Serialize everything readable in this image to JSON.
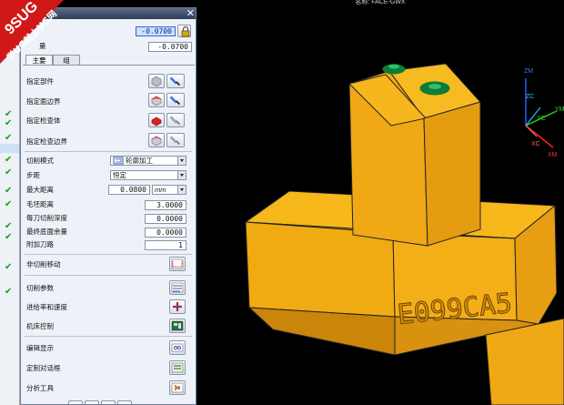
{
  "viewport": {
    "title": "名称: FACE-GWX",
    "engraving": "E099CA5"
  },
  "watermark": {
    "line1": "9SUG",
    "line2": "学UG就上UG网"
  },
  "dialog": {
    "top_value": "-0.0700",
    "top_label": "量",
    "second_value": "-0.0700",
    "tabs": [
      "主要",
      "组"
    ],
    "geometry": [
      {
        "label": "指定部件"
      },
      {
        "label": "指定面边界"
      },
      {
        "label": "指定检查体"
      },
      {
        "label": "指定检查边界"
      }
    ],
    "cut_mode": {
      "label": "切削模式",
      "value": "轮廓加工"
    },
    "step": {
      "label": "步距",
      "value": "恒定"
    },
    "max_distance": {
      "label": "最大距离",
      "value": "0.0800",
      "unit": "mm"
    },
    "blank_distance": {
      "label": "毛坯距离",
      "value": "3.0000"
    },
    "depth_per_cut": {
      "label": "每刀切削深度",
      "value": "0.0000"
    },
    "final_floor_stock": {
      "label": "最终底面余量",
      "value": "0.0000"
    },
    "additional_passes": {
      "label": "附加刀路",
      "value": "1"
    },
    "actions": [
      {
        "label": "非切削移动"
      },
      {
        "label": "切削参数"
      },
      {
        "label": "进给率和速度"
      },
      {
        "label": "机床控制"
      },
      {
        "label": "编辑显示"
      },
      {
        "label": "定制对话框"
      },
      {
        "label": "分析工具"
      }
    ]
  },
  "triad": {
    "zm": "ZM",
    "zc": "ZC",
    "yc": "YC",
    "ym": "YM",
    "xc": "XC",
    "xm": "XM"
  }
}
